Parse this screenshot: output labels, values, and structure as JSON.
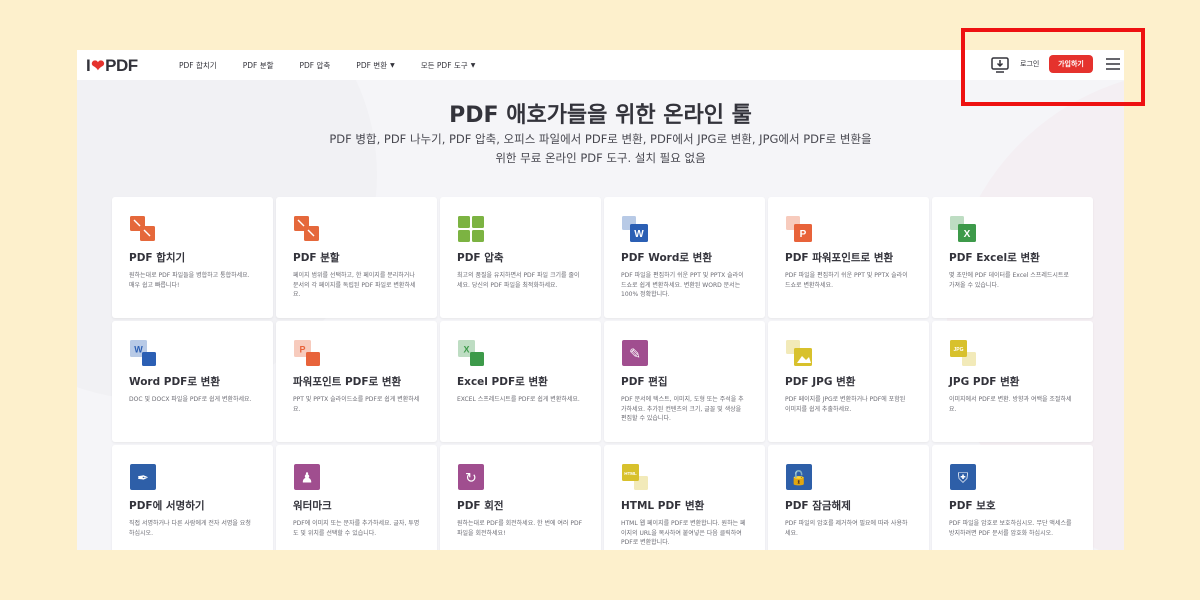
{
  "header": {
    "logo_left": "I",
    "logo_right": "PDF",
    "nav": [
      {
        "label": "PDF 합치기",
        "dropdown": false
      },
      {
        "label": "PDF 분할",
        "dropdown": false
      },
      {
        "label": "PDF 압축",
        "dropdown": false
      },
      {
        "label": "PDF 변환",
        "dropdown": true
      },
      {
        "label": "모든 PDF 도구",
        "dropdown": true
      }
    ],
    "login": "로그인",
    "signup": "가입하기"
  },
  "hero": {
    "title": "PDF 애호가들을 위한 온라인 툴",
    "subtitle": "PDF 병합, PDF 나누기, PDF 압축, 오피스 파일에서 PDF로 변환, PDF에서 JPG로 변환, JPG에서 PDF로 변환을 위한 무료 온라인 PDF 도구. 설치 필요 없음"
  },
  "colors": {
    "brand_red": "#e5322d",
    "highlight": "#ee1111"
  },
  "tools": [
    {
      "title": "PDF 합치기",
      "desc": "원하는대로 PDF 파일들을 병합하고 통합하세요. 매우 쉽고 빠릅니다!",
      "icon": "merge-pdf-icon",
      "color": "#e5683b"
    },
    {
      "title": "PDF 분할",
      "desc": "페이지 범위를 선택하고, 한 페이지를 분리하거나 문서의 각 페이지를 독립된 PDF 파일로 변환하세요.",
      "icon": "split-pdf-icon",
      "color": "#e5683b"
    },
    {
      "title": "PDF 압축",
      "desc": "최고의 품질을 유지하면서 PDF 파일 크기를 줄이세요. 당신의 PDF 파일을 최적화하세요.",
      "icon": "compress-pdf-icon",
      "color": "#7cb342"
    },
    {
      "title": "PDF Word로 변환",
      "desc": "PDF 파일을 편집하기 쉬운 PPT 및 PPTX 슬라이드쇼로 쉽게 변환하세요. 변환된 WORD 문서는 100% 정확합니다.",
      "icon": "pdf-to-word-icon",
      "color": "#2b5fb4"
    },
    {
      "title": "PDF 파워포인트로 변환",
      "desc": "PDF 파일을 편집하기 쉬운 PPT 및 PPTX 슬라이드쇼로 변환하세요.",
      "icon": "pdf-to-powerpoint-icon",
      "color": "#e8633a"
    },
    {
      "title": "PDF Excel로 변환",
      "desc": "몇 초만에 PDF 데이터를 Excel 스프레드시트로 가져올 수 있습니다.",
      "icon": "pdf-to-excel-icon",
      "color": "#3d9a4a"
    },
    {
      "title": "Word PDF로 변환",
      "desc": "DOC 및 DOCX 파일을 PDF로 쉽게 변환하세요.",
      "icon": "word-to-pdf-icon",
      "color": "#2b5fb4"
    },
    {
      "title": "파워포인트 PDF로 변환",
      "desc": "PPT 및 PPTX 슬라이드쇼를 PDF로 쉽게 변환하세요.",
      "icon": "powerpoint-to-pdf-icon",
      "color": "#e8633a"
    },
    {
      "title": "Excel PDF로 변환",
      "desc": "EXCEL 스프레드시트를 PDF로 쉽게 변환하세요.",
      "icon": "excel-to-pdf-icon",
      "color": "#3d9a4a"
    },
    {
      "title": "PDF 편집",
      "desc": "PDF 문서에 텍스트, 이미지, 도형 또는 주석을 추가하세요. 추가된 컨텐츠의 크기, 글꼴 및 색상을 편집할 수 있습니다.",
      "icon": "edit-pdf-icon",
      "color": "#a04e8f"
    },
    {
      "title": "PDF JPG 변환",
      "desc": "PDF 페이지를 JPG로 변환하거나 PDF에 포함된 이미지를 쉽게 추출하세요.",
      "icon": "pdf-to-jpg-icon",
      "color": "#d8c12c"
    },
    {
      "title": "JPG PDF 변환",
      "desc": "이미지에서 PDF로 변환. 방향과 여백을 조절하세요.",
      "icon": "jpg-to-pdf-icon",
      "color": "#d8c12c"
    },
    {
      "title": "PDF에 서명하기",
      "desc": "직접 서명하거나 다른 사람에게 전자 서명을 요청하십시오.",
      "icon": "sign-pdf-icon",
      "color": "#2e5fa8"
    },
    {
      "title": "워터마크",
      "desc": "PDF에 이미지 또는 문자를 추가하세요. 글자, 투명도 및 위치를 선택할 수 있습니다.",
      "icon": "watermark-icon",
      "color": "#a04e8f"
    },
    {
      "title": "PDF 회전",
      "desc": "원하는대로 PDF를 회전하세요. 한 번에 여러 PDF 파일을 회전하세요!",
      "icon": "rotate-pdf-icon",
      "color": "#a04e8f"
    },
    {
      "title": "HTML PDF 변환",
      "desc": "HTML 웹 페이지를 PDF로 변환합니다. 원하는 페이지의 URL을 복사하여 붙여넣은 다음 클릭하여 PDF로 변환합니다.",
      "icon": "html-to-pdf-icon",
      "color": "#d8c12c"
    },
    {
      "title": "PDF 잠금해제",
      "desc": "PDF 파일의 암호를 제거하여 필요에 따라 사용하세요.",
      "icon": "unlock-pdf-icon",
      "color": "#2e5fa8"
    },
    {
      "title": "PDF 보호",
      "desc": "PDF 파일을 암호로 보호하십시오. 무단 액세스를 방지하려면 PDF 문서를 암호화 하십시오.",
      "icon": "protect-pdf-icon",
      "color": "#2e5fa8"
    }
  ]
}
